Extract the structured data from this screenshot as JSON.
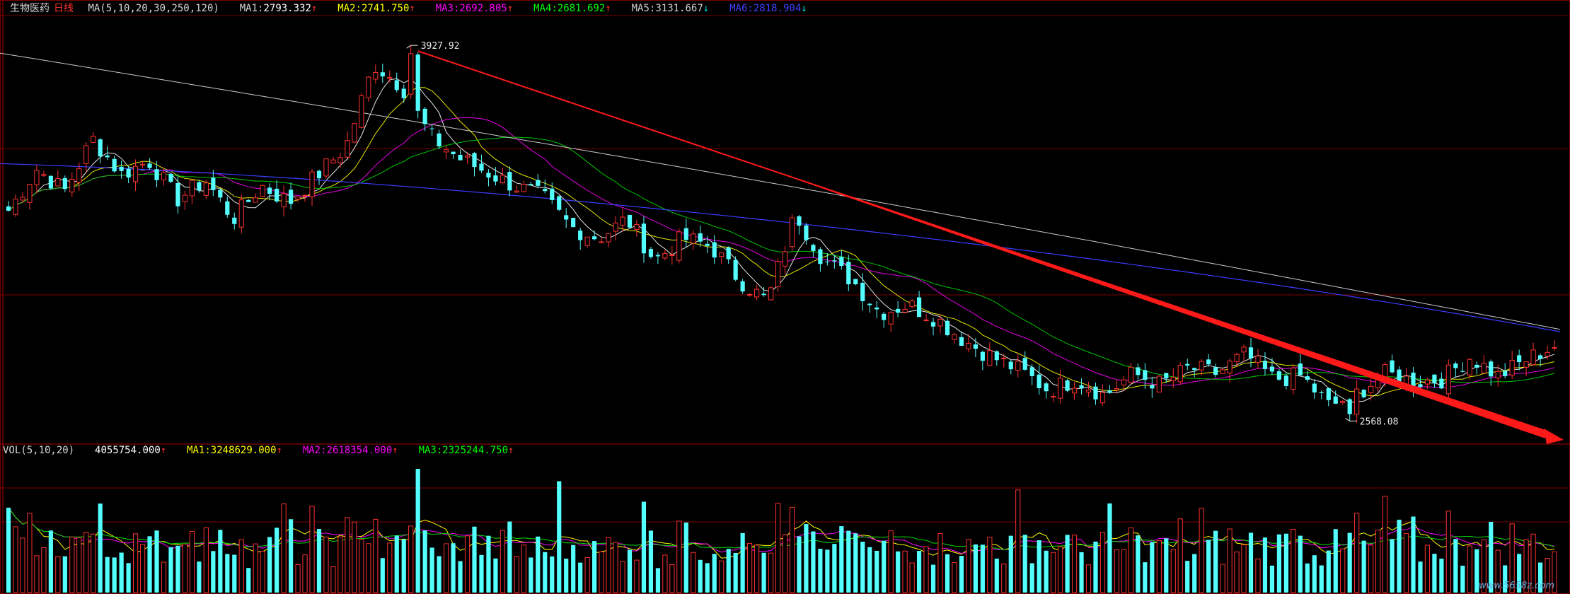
{
  "header": {
    "name": "生物医药",
    "period": "日线",
    "ma_params": "MA(5,10,20,30,250,120)",
    "items": [
      {
        "label": "MA1:",
        "value": "2793.332",
        "arrow": "↑",
        "color": "#ffffff"
      },
      {
        "label": "MA2:",
        "value": "2741.750",
        "arrow": "↑",
        "color": "#ffff00"
      },
      {
        "label": "MA3:",
        "value": "2692.805",
        "arrow": "↑",
        "color": "#ff00ff"
      },
      {
        "label": "MA4:",
        "value": "2681.692",
        "arrow": "↑",
        "color": "#00ff00"
      },
      {
        "label": "MA5:",
        "value": "3131.667",
        "arrow": "↓",
        "color": "#c8c8c8"
      },
      {
        "label": "MA6:",
        "value": "2818.904",
        "arrow": "↓",
        "color": "#3c3cff"
      }
    ]
  },
  "vol_header": {
    "params": "VOL(5,10,20)",
    "value": "4055754.000",
    "value_arrow": "↑",
    "items": [
      {
        "label": "MA1:",
        "value": "3248629.000",
        "arrow": "↑",
        "color": "#ffff00"
      },
      {
        "label": "MA2:",
        "value": "2618354.000",
        "arrow": "↑",
        "color": "#ff00ff"
      },
      {
        "label": "MA3:",
        "value": "2325244.750",
        "arrow": "↑",
        "color": "#00ff00"
      }
    ]
  },
  "annotations": {
    "high": "3927.92",
    "low": "2568.08"
  },
  "watermark": "www.5658z.com",
  "colors": {
    "up": "#ff3030",
    "down": "#54ffff",
    "trendline": "#ff1a1a",
    "grid": "#7a0000"
  },
  "chart_data": {
    "type": "candlestick",
    "title": "生物医药日线",
    "price_range": [
      2500,
      4000
    ],
    "high_marker": 3927.92,
    "low_marker": 2568.08,
    "close_anchors": [
      3330,
      3480,
      3400,
      3590,
      3460,
      3510,
      3370,
      3440,
      3300,
      3420,
      3360,
      3460,
      3560,
      3860,
      3780,
      3600,
      3520,
      3470,
      3420,
      3380,
      3270,
      3230,
      3300,
      3150,
      3230,
      3200,
      3080,
      3000,
      3320,
      3150,
      3080,
      2960,
      2990,
      2940,
      2860,
      2800,
      2750,
      2680,
      2720,
      2660,
      2740,
      2700,
      2760,
      2740,
      2810,
      2720,
      2730,
      2620,
      2670,
      2740,
      2710,
      2720,
      2800,
      2730,
      2790,
      2840
    ],
    "indicators": {
      "MA1_final": 2793.332,
      "MA2_final": 2741.75,
      "MA3_final": 2692.805,
      "MA4_final": 2681.692,
      "MA5_final": 3131.667,
      "MA6_final": 2818.904
    },
    "volume": {
      "label": "VOL(5,10,20)",
      "last": 4055754.0,
      "MA1": 3248629.0,
      "MA2": 2618354.0,
      "MA3": 2325244.75
    }
  }
}
